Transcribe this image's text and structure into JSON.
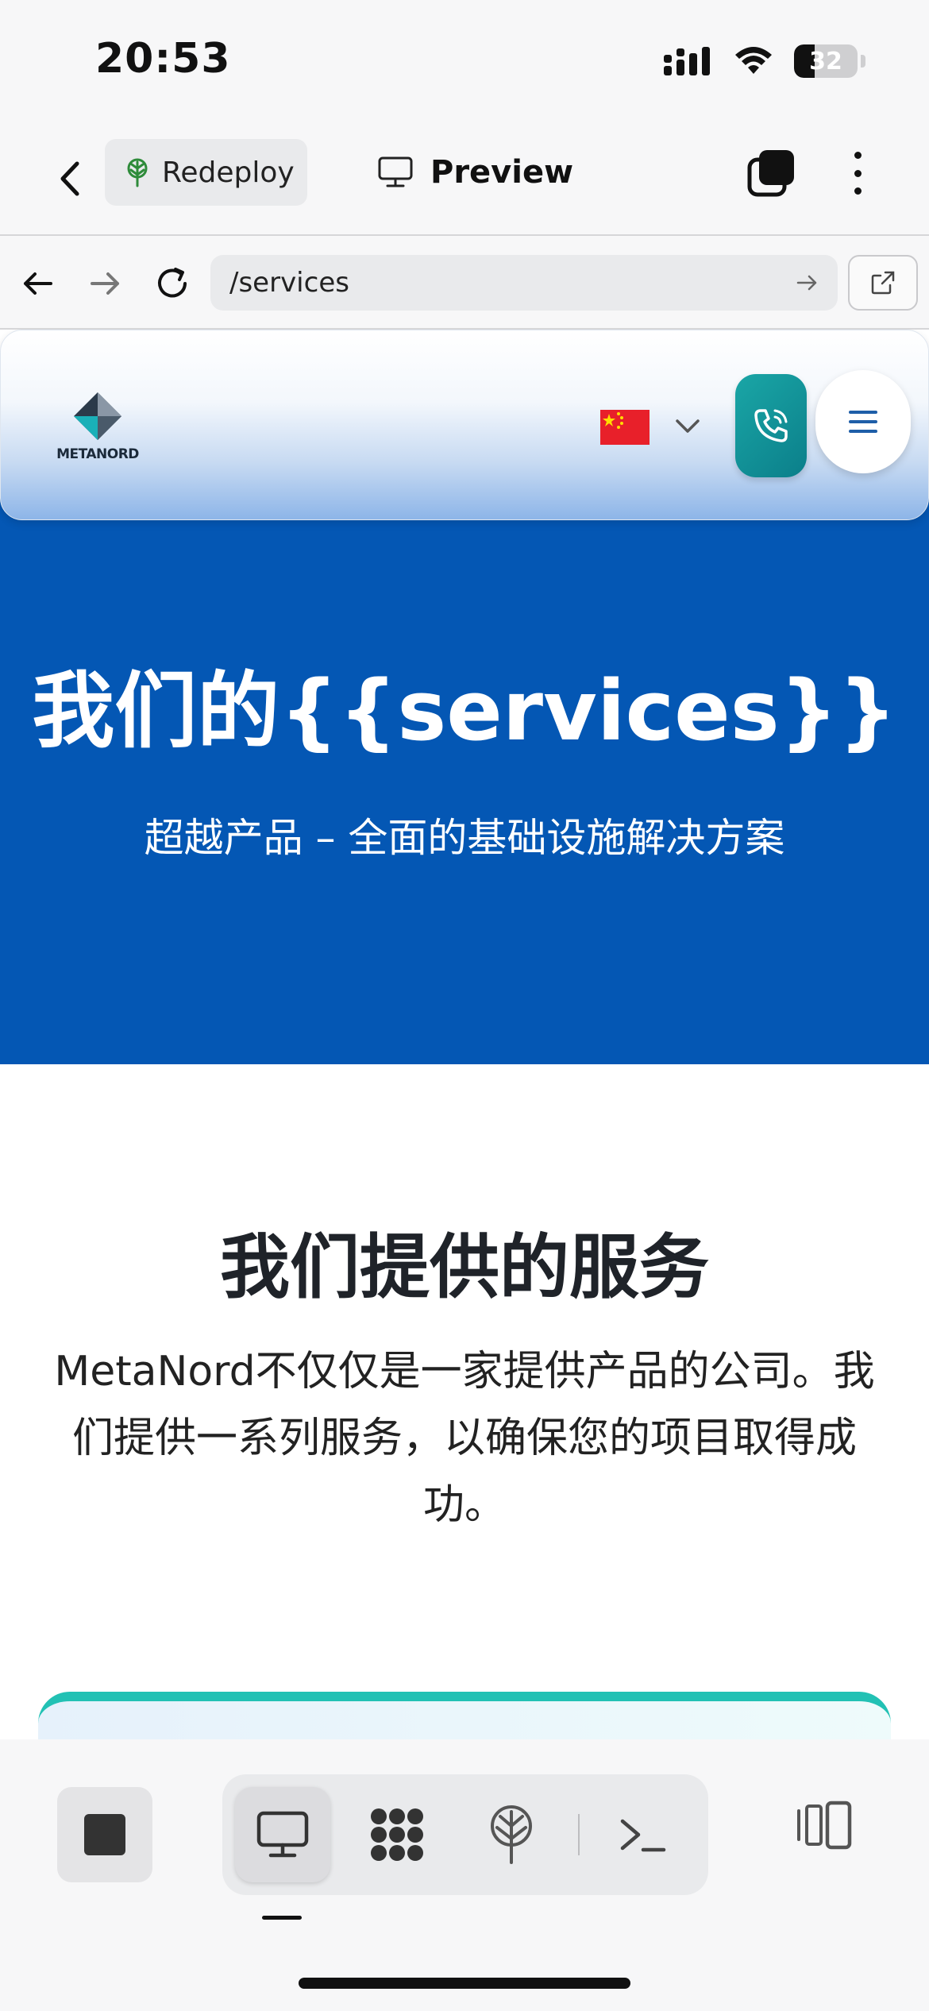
{
  "status_bar": {
    "time": "20:53",
    "battery": "32"
  },
  "app_bar": {
    "redeploy_label": "Redeploy",
    "preview_label": "Preview"
  },
  "browser": {
    "url": "/services"
  },
  "site": {
    "logo_text": "METANORD",
    "hero_title": "我们的{{services}}",
    "hero_subtitle": "超越产品 – 全面的基础设施解决方案",
    "section_title": "我们提供的服务",
    "section_description": "MetaNord不仅仅是一家提供产品的公司。我们提供一系列服务，以确保您的项目取得成功。"
  },
  "colors": {
    "hero_blue": "#0457b4",
    "teal": "#1aa6a6",
    "accent_green": "#22c1b4"
  },
  "icons": [
    "back-icon",
    "tree-icon",
    "monitor-icon",
    "tabs-icon",
    "more-icon",
    "arrow-left-icon",
    "arrow-right-icon",
    "reload-icon",
    "go-icon",
    "external-link-icon",
    "phone-icon",
    "hamburger-icon",
    "stop-icon",
    "desktop-icon",
    "apps-icon",
    "deploy-icon",
    "terminal-icon",
    "split-view-icon"
  ]
}
